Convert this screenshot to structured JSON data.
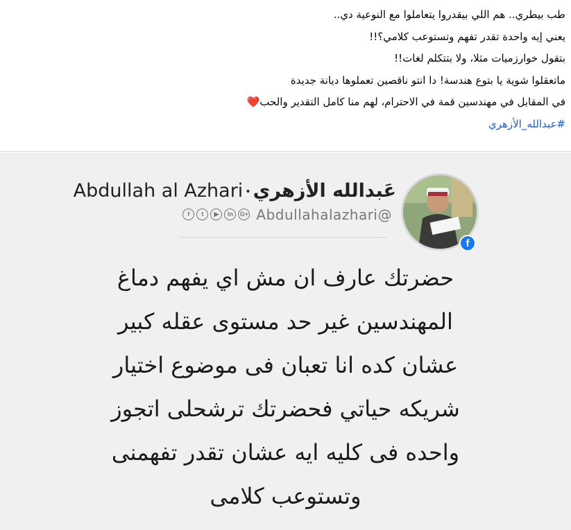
{
  "post": {
    "lines": [
      "طب بيطري.. هم اللي بيقدروا يتعاملوا مع النوعية دي..",
      "يعني إيه واحدة تقدر تفهم وتستوعب كلامي؟!!",
      "بتقول خوارزميات مثلا، ولا بتتكلم لغات!!",
      "ماتعقلوا شوية يا بتوع هندسة! دا انتو ناقصين تعملوها ديانة جديدة",
      "في المقابل في مهندسين قمة في الاحترام، لهم منا كامل التقدير والحب"
    ],
    "heart_emoji": "❤️",
    "hashtag": "#عبدالله_الأزهري"
  },
  "card": {
    "name_arabic": "عَبدالله الأزهري",
    "name_dot": "•",
    "name_latin": "Abdullah al Azhari",
    "handle": "Abdullahalazhari@",
    "social_icons": [
      "facebook-icon",
      "twitter-icon",
      "youtube-icon",
      "linkedin-icon",
      "google-plus-icon"
    ],
    "social_glyphs": [
      "f",
      "t",
      "▶",
      "in",
      "G+"
    ],
    "quote_lines": [
      "حضرتك عارف ان مش اي يفهم دماغ",
      "المهندسين غير حد مستوى عقله كبير",
      "عشان كده انا تعبان فى موضوع اختيار",
      "شريكه حياتي فحضرتك ترشحلى اتجوز",
      "واحده فى كليه ايه عشان تقدر تفهمنى",
      "وتستوعب كلامى"
    ]
  },
  "colors": {
    "hashtag_link": "#1a5ae0",
    "card_background": "#f0f0f0",
    "facebook_blue": "#1877f2",
    "heart": "#e0245e"
  }
}
